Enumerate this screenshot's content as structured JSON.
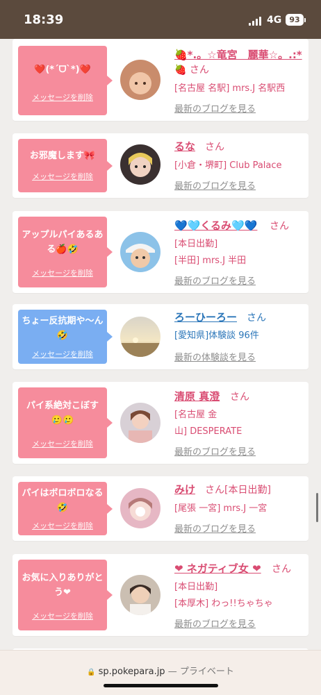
{
  "status_bar": {
    "time": "18:39",
    "network": "4G",
    "battery": "93"
  },
  "cards": [
    {
      "message": "❤️(*ˊᗜˋ*)❤️",
      "delete_label": "メッセージを削除",
      "name": "🍓*.。☆竜宮　麗華☆。.:*",
      "name_suffix": "🍓 さん",
      "line1": "[名古屋 名駅] mrs.J 名駅西",
      "line2": "",
      "link": "最新のブログを見る"
    },
    {
      "message": "お邪魔します🎀",
      "delete_label": "メッセージを削除",
      "name": "るな",
      "name_suffix": "さん",
      "line1": "[小倉・堺町] Club Palace",
      "line2": "",
      "link": "最新のブログを見る"
    },
    {
      "message": "アップルパイあるある🍎🤣",
      "delete_label": "メッセージを削除",
      "name": "💙🩵くるみ🩵💙",
      "name_suffix": "さん",
      "line1": "[本日出勤]",
      "line2": "[半田] mrs.J 半田",
      "link": "最新のブログを見る"
    },
    {
      "message": "ちょー反抗期や〜ん🤣",
      "delete_label": "メッセージを削除",
      "name": "ろーひーろー",
      "name_suffix": "さん",
      "line1": "[愛知県]体験談 96件",
      "line2": "",
      "link": "最新の体験談を見る",
      "theme": "blue"
    },
    {
      "message": "パイ系絶対こぼす🥲🥲",
      "delete_label": "メッセージを削除",
      "name": "清原 真澄",
      "name_suffix": "さん",
      "line1": "[名古屋 金",
      "line2": "山] DESPERATE",
      "link": "最新のブログを見る"
    },
    {
      "message": "パイはボロボロなる🤣",
      "delete_label": "メッセージを削除",
      "name": "みけ",
      "name_suffix": "さん[本日出勤]",
      "line1": "[尾張 一宮] mrs.J 一宮",
      "line2": "",
      "link": "最新のブログを見る"
    },
    {
      "message": "お気に入りありがとう❤",
      "delete_label": "メッセージを削除",
      "name": "❤ ネガティブ女 ❤",
      "name_suffix": "さん",
      "line1": "[本日出勤]",
      "line2": "[本厚木] わっ!!ちゃちゃ",
      "link": "最新のブログを見る"
    }
  ],
  "browser": {
    "domain": "sp.pokepara.jp",
    "privacy": "— プライベート"
  },
  "colors": {
    "pink": "#f68c9c",
    "blue": "#7aaef2",
    "name_pink": "#d94c72",
    "name_blue": "#2b76b9",
    "status_bg": "#5b4a3d"
  }
}
